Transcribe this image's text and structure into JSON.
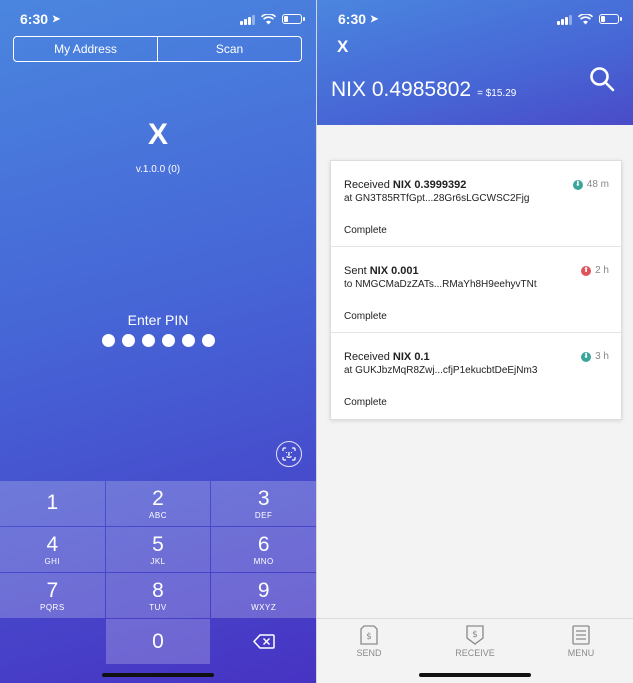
{
  "left_screen": {
    "status_bar": {
      "time": "6:30"
    },
    "segments": [
      "My Address",
      "Scan"
    ],
    "logo": "X",
    "version": "v.1.0.0 (0)",
    "pin_prompt": "Enter PIN",
    "pin_length": 6,
    "keypad": [
      {
        "num": "1",
        "letters": ""
      },
      {
        "num": "2",
        "letters": "ABC"
      },
      {
        "num": "3",
        "letters": "DEF"
      },
      {
        "num": "4",
        "letters": "GHI"
      },
      {
        "num": "5",
        "letters": "JKL"
      },
      {
        "num": "6",
        "letters": "MNO"
      },
      {
        "num": "7",
        "letters": "PQRS"
      },
      {
        "num": "8",
        "letters": "TUV"
      },
      {
        "num": "9",
        "letters": "WXYZ"
      },
      {
        "num": "0",
        "letters": ""
      }
    ],
    "icons": {
      "face_id": "face-id-icon",
      "delete": "backspace-icon"
    }
  },
  "right_screen": {
    "status_bar": {
      "time": "6:30"
    },
    "close_label": "X",
    "balance": {
      "amount": "NIX 0.4985802",
      "fiat": "= $15.29"
    },
    "icons": {
      "search": "search-icon"
    },
    "transactions": [
      {
        "verb": "Received",
        "coin_amount": "NIX 0.3999392",
        "address": "at GN3T85RTfGpt...28Gr6sLGCWSC2Fjg",
        "status": "Complete",
        "time": "48 m",
        "direction": "in",
        "dot_color": "#3aa59a"
      },
      {
        "verb": "Sent",
        "coin_amount": "NIX 0.001",
        "address": "to NMGCMaDzZATs...RMaYh8H9eehyvTNt",
        "status": "Complete",
        "time": "2 h",
        "direction": "out",
        "dot_color": "#e0525a"
      },
      {
        "verb": "Received",
        "coin_amount": "NIX 0.1",
        "address": "at GUKJbzMqR8Zwj...cfjP1ekucbtDeEjNm3",
        "status": "Complete",
        "time": "3 h",
        "direction": "in",
        "dot_color": "#3aa59a"
      }
    ],
    "tabbar": [
      {
        "label": "SEND",
        "icon": "send-icon"
      },
      {
        "label": "RECEIVE",
        "icon": "receive-icon"
      },
      {
        "label": "MENU",
        "icon": "menu-icon"
      }
    ]
  }
}
